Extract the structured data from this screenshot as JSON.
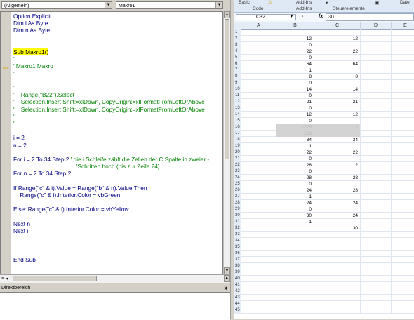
{
  "vba": {
    "object_dropdown": "(Allgemein)",
    "proc_dropdown": "Makro1",
    "code_lines": [
      {
        "text": "Option Explicit",
        "cls": "k"
      },
      {
        "text": "Dim i As Byte",
        "cls": "k"
      },
      {
        "text": "Dim n As Byte",
        "cls": "k"
      },
      {
        "text": "",
        "cls": ""
      },
      {
        "text": "",
        "cls": ""
      },
      {
        "text": "Sub Makro1()",
        "cls": "hl"
      },
      {
        "text": "'",
        "cls": "g"
      },
      {
        "text": "' Makro1 Makro",
        "cls": "g"
      },
      {
        "text": "'",
        "cls": "g"
      },
      {
        "text": "",
        "cls": ""
      },
      {
        "text": "'",
        "cls": "g"
      },
      {
        "text": "'    Range(\"B22\").Select",
        "cls": "g"
      },
      {
        "text": "'    Selection.Insert Shift:=xlDown, CopyOrigin:=xlFormatFromLeftOrAbove",
        "cls": "g"
      },
      {
        "text": "'    Selection.Insert Shift:=xlDown, CopyOrigin:=xlFormatFromLeftOrAbove",
        "cls": "g"
      },
      {
        "text": "'",
        "cls": "g"
      },
      {
        "text": "'",
        "cls": "g"
      },
      {
        "text": "",
        "cls": ""
      },
      {
        "text": "i = 2",
        "cls": "k"
      },
      {
        "text": "n = 2",
        "cls": "k"
      },
      {
        "text": "",
        "cls": ""
      },
      {
        "text": "For i = 2 To 34 Step 2 ' die i Schleife zählt die Zellen der C Spalte in zweier -",
        "cls": "mix1"
      },
      {
        "text": "                                       'Schritten hoch (bis zur Zeile 24)",
        "cls": "g"
      },
      {
        "text": "For n = 2 To 34 Step 2",
        "cls": "k"
      },
      {
        "text": "",
        "cls": ""
      },
      {
        "text": "If Range(\"c\" & i).Value = Range(\"b\" & n).Value Then",
        "cls": "k"
      },
      {
        "text": "    Range(\"c\" & i).Interior.Color = vbGreen",
        "cls": "k"
      },
      {
        "text": "",
        "cls": ""
      },
      {
        "text": "Else: Range(\"c\" & i).Interior.Color = vbYellow",
        "cls": "k"
      },
      {
        "text": "",
        "cls": ""
      },
      {
        "text": "Next n",
        "cls": "k"
      },
      {
        "text": "Next i",
        "cls": "k"
      },
      {
        "text": "",
        "cls": ""
      },
      {
        "text": "",
        "cls": ""
      },
      {
        "text": "",
        "cls": ""
      },
      {
        "text": "End Sub",
        "cls": "k"
      }
    ],
    "direkt_title": "Direktbereich",
    "direkt_close": "x"
  },
  "excel": {
    "ribbon": {
      "basic": "Basic",
      "code": "Code",
      "addins_top": "Add-Ins",
      "addins_bottom": "Add-Ins",
      "steuer": "Steuerelemente",
      "date": "Date"
    },
    "namebox": "C32",
    "formula_value": "30",
    "fx": "fx",
    "columns": [
      "A",
      "B",
      "C",
      "D",
      "E"
    ],
    "rows": [
      {
        "n": "1",
        "b": "",
        "c": ""
      },
      {
        "n": "2",
        "b": "12",
        "c": "12"
      },
      {
        "n": "3",
        "b": "0",
        "c": ""
      },
      {
        "n": "4",
        "b": "22",
        "c": "22"
      },
      {
        "n": "5",
        "b": "0",
        "c": ""
      },
      {
        "n": "6",
        "b": "64",
        "c": "64"
      },
      {
        "n": "7",
        "b": "1",
        "c": ""
      },
      {
        "n": "8",
        "b": "8",
        "c": "8"
      },
      {
        "n": "9",
        "b": "0",
        "c": ""
      },
      {
        "n": "10",
        "b": "14",
        "c": "14"
      },
      {
        "n": "11",
        "b": "0",
        "c": ""
      },
      {
        "n": "12",
        "b": "21",
        "c": "21"
      },
      {
        "n": "13",
        "b": "0",
        "c": ""
      },
      {
        "n": "14",
        "b": "12",
        "c": "12"
      },
      {
        "n": "15",
        "b": "0",
        "c": ""
      },
      {
        "n": "16",
        "b": "1775",
        "c": "12",
        "sel": true
      },
      {
        "n": "17",
        "b": "158",
        "c": "",
        "sel": true
      },
      {
        "n": "18",
        "b": "34",
        "c": "34"
      },
      {
        "n": "19",
        "b": "1",
        "c": ""
      },
      {
        "n": "20",
        "b": "22",
        "c": "22"
      },
      {
        "n": "21",
        "b": "0",
        "c": ""
      },
      {
        "n": "22",
        "b": "28",
        "c": "12"
      },
      {
        "n": "23",
        "b": "0",
        "c": ""
      },
      {
        "n": "24",
        "b": "28",
        "c": "28"
      },
      {
        "n": "25",
        "b": "0",
        "c": ""
      },
      {
        "n": "26",
        "b": "24",
        "c": "28"
      },
      {
        "n": "27",
        "b": "1",
        "c": ""
      },
      {
        "n": "28",
        "b": "24",
        "c": "24"
      },
      {
        "n": "29",
        "b": "0",
        "c": ""
      },
      {
        "n": "30",
        "b": "30",
        "c": "24"
      },
      {
        "n": "31",
        "b": "1",
        "c": ""
      },
      {
        "n": "32",
        "b": "",
        "c": "30"
      },
      {
        "n": "33",
        "b": "",
        "c": ""
      },
      {
        "n": "34",
        "b": "",
        "c": ""
      },
      {
        "n": "35",
        "b": "",
        "c": ""
      },
      {
        "n": "36",
        "b": "",
        "c": ""
      },
      {
        "n": "37",
        "b": "",
        "c": ""
      },
      {
        "n": "38",
        "b": "",
        "c": ""
      },
      {
        "n": "39",
        "b": "",
        "c": ""
      },
      {
        "n": "40",
        "b": "",
        "c": ""
      },
      {
        "n": "41",
        "b": "",
        "c": ""
      },
      {
        "n": "42",
        "b": "",
        "c": ""
      },
      {
        "n": "43",
        "b": "",
        "c": ""
      },
      {
        "n": "44",
        "b": "",
        "c": ""
      },
      {
        "n": "45",
        "b": "",
        "c": ""
      }
    ]
  }
}
